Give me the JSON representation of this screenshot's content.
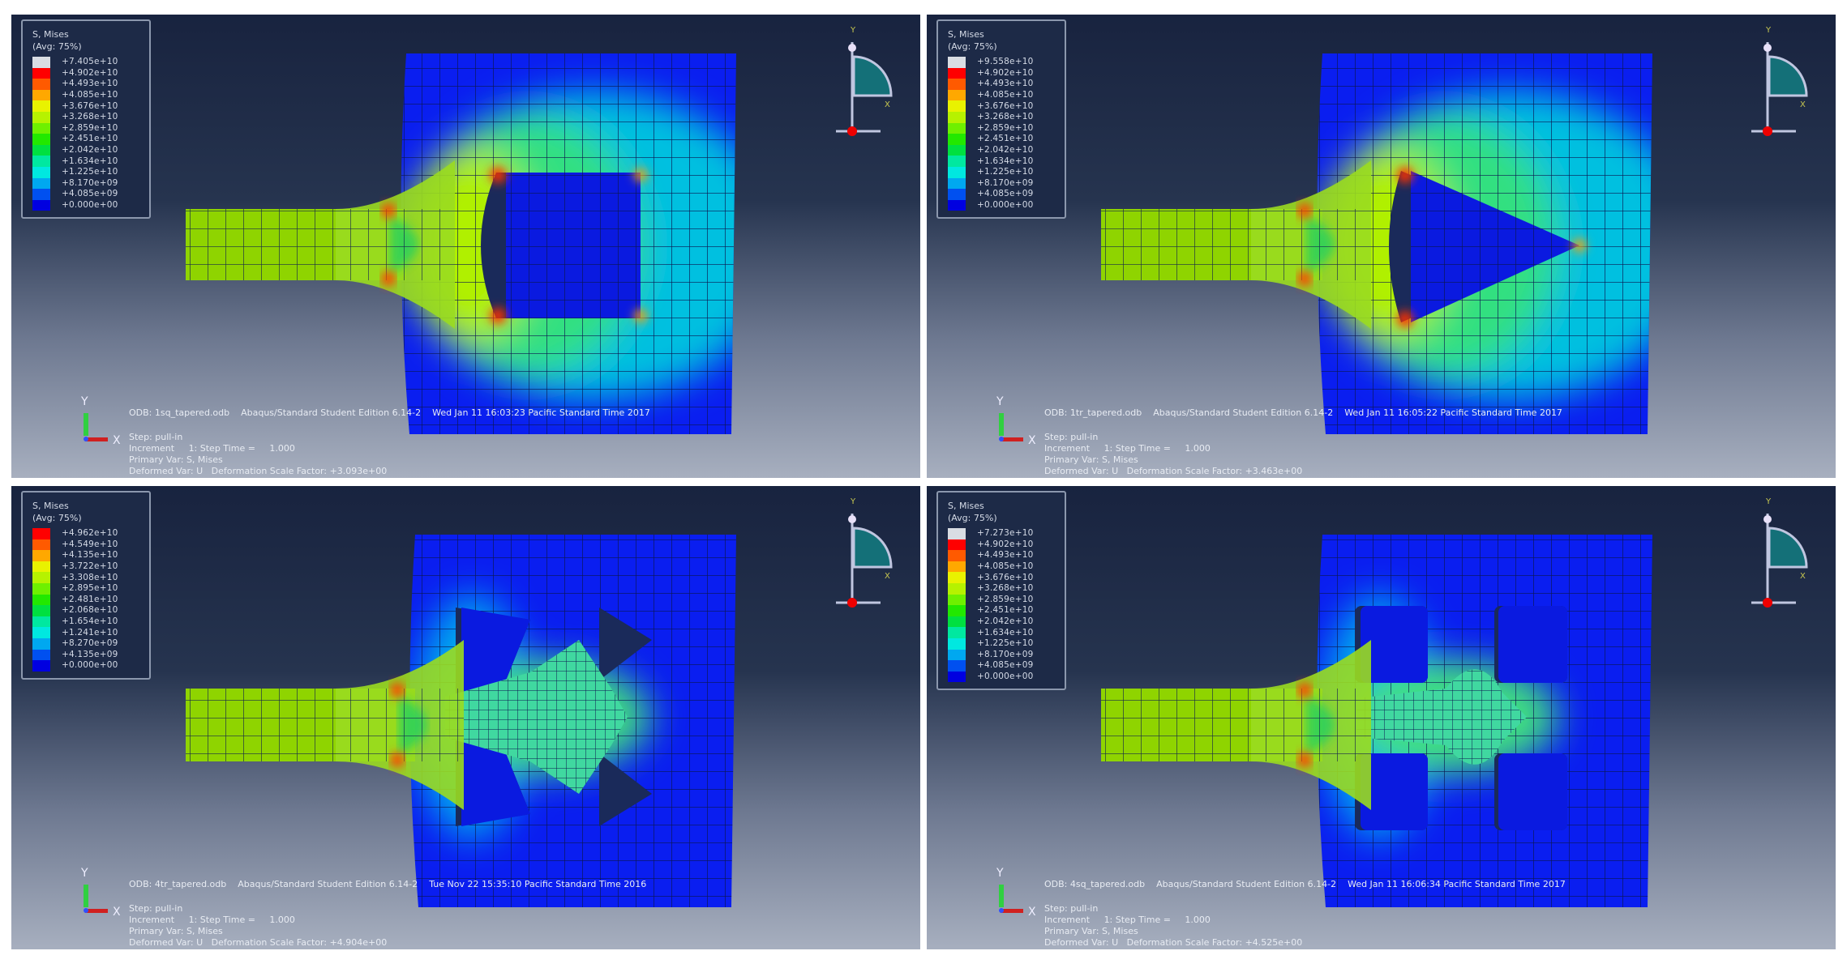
{
  "legend_common": {
    "title": "S, Mises",
    "avg": "(Avg: 75%)"
  },
  "colors": {
    "scale14": [
      "#d9dde3",
      "#ff0000",
      "#ff5a00",
      "#ffa800",
      "#e9f200",
      "#b6f200",
      "#6ef000",
      "#22e800",
      "#00e040",
      "#00e8a0",
      "#00e8e0",
      "#00a8f0",
      "#0050f0",
      "#0000e0"
    ],
    "scale13": [
      "#ff0000",
      "#ff5a00",
      "#ffa800",
      "#e9f200",
      "#b6f200",
      "#6ef000",
      "#22e800",
      "#00e040",
      "#00e8a0",
      "#00e8e0",
      "#00a8f0",
      "#0050f0",
      "#0000e0"
    ],
    "plate": "#0a1ef0",
    "beam": "#8fd400"
  },
  "panels": [
    {
      "shape": "square-hole",
      "legend_values": [
        "+7.405e+10",
        "+4.902e+10",
        "+4.493e+10",
        "+4.085e+10",
        "+3.676e+10",
        "+3.268e+10",
        "+2.859e+10",
        "+2.451e+10",
        "+2.042e+10",
        "+1.634e+10",
        "+1.225e+10",
        "+8.170e+09",
        "+4.085e+09",
        "+0.000e+00"
      ],
      "odb_line": "ODB: 1sq_tapered.odb    Abaqus/Standard Student Edition 6.14-2    Wed Jan 11 16:03:23 Pacific Standard Time 2017",
      "step": "Step: pull-in",
      "increment": "Increment     1: Step Time =     1.000",
      "primary_var": "Primary Var: S, Mises",
      "deformed_var": "Deformed Var: U   Deformation Scale Factor: +3.093e+00"
    },
    {
      "shape": "triangle-hole",
      "legend_values": [
        "+9.558e+10",
        "+4.902e+10",
        "+4.493e+10",
        "+4.085e+10",
        "+3.676e+10",
        "+3.268e+10",
        "+2.859e+10",
        "+2.451e+10",
        "+2.042e+10",
        "+1.634e+10",
        "+1.225e+10",
        "+8.170e+09",
        "+4.085e+09",
        "+0.000e+00"
      ],
      "odb_line": "ODB: 1tr_tapered.odb    Abaqus/Standard Student Edition 6.14-2    Wed Jan 11 16:05:22 Pacific Standard Time 2017",
      "step": "Step: pull-in",
      "increment": "Increment     1: Step Time =     1.000",
      "primary_var": "Primary Var: S, Mises",
      "deformed_var": "Deformed Var: U   Deformation Scale Factor: +3.463e+00"
    },
    {
      "shape": "four-triangle-holes",
      "legend_values": [
        "+4.962e+10",
        "+4.549e+10",
        "+4.135e+10",
        "+3.722e+10",
        "+3.308e+10",
        "+2.895e+10",
        "+2.481e+10",
        "+2.068e+10",
        "+1.654e+10",
        "+1.241e+10",
        "+8.270e+09",
        "+4.135e+09",
        "+0.000e+00"
      ],
      "odb_line": "ODB: 4tr_tapered.odb    Abaqus/Standard Student Edition 6.14-2    Tue Nov 22 15:35:10 Pacific Standard Time 2016",
      "step": "Step: pull-in",
      "increment": "Increment     1: Step Time =     1.000",
      "primary_var": "Primary Var: S, Mises",
      "deformed_var": "Deformed Var: U   Deformation Scale Factor: +4.904e+00"
    },
    {
      "shape": "four-square-holes",
      "legend_values": [
        "+7.273e+10",
        "+4.902e+10",
        "+4.493e+10",
        "+4.085e+10",
        "+3.676e+10",
        "+3.268e+10",
        "+2.859e+10",
        "+2.451e+10",
        "+2.042e+10",
        "+1.634e+10",
        "+1.225e+10",
        "+8.170e+09",
        "+4.085e+09",
        "+0.000e+00"
      ],
      "odb_line": "ODB: 4sq_tapered.odb    Abaqus/Standard Student Edition 6.14-2    Wed Jan 11 16:06:34 Pacific Standard Time 2017",
      "step": "Step: pull-in",
      "increment": "Increment     1: Step Time =     1.000",
      "primary_var": "Primary Var: S, Mises",
      "deformed_var": "Deformed Var: U   Deformation Scale Factor: +4.525e+00"
    }
  ],
  "triad_labels": {
    "y": "Y",
    "x": "X"
  }
}
